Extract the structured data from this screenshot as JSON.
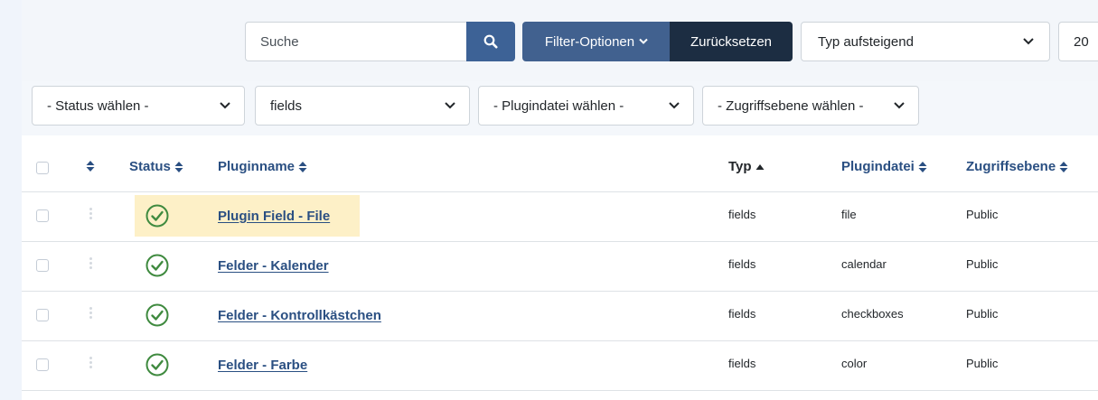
{
  "toolbar": {
    "search_placeholder": "Suche",
    "filter_label": "Filter-Optionen",
    "reset_label": "Zurücksetzen",
    "sort_value": "Typ aufsteigend",
    "limit_value": "20"
  },
  "filters": {
    "status": "- Status wählen -",
    "folder": "fields",
    "element": "- Plugindatei wählen -",
    "access": "- Zugriffsebene wählen -"
  },
  "table": {
    "columns": {
      "status": "Status",
      "name": "Pluginname",
      "type": "Typ",
      "element": "Plugindatei",
      "access": "Zugriffsebene"
    },
    "rows": [
      {
        "name": "Plugin Field - File",
        "type": "fields",
        "element": "file",
        "access": "Public"
      },
      {
        "name": "Felder - Kalender",
        "type": "fields",
        "element": "calendar",
        "access": "Public"
      },
      {
        "name": "Felder - Kontrollkästchen",
        "type": "fields",
        "element": "checkboxes",
        "access": "Public"
      },
      {
        "name": "Felder - Farbe",
        "type": "fields",
        "element": "color",
        "access": "Public"
      }
    ]
  },
  "colors": {
    "primary": "#41618f",
    "dark": "#1c2d42",
    "success": "#3f8a3f",
    "highlight": "#fdf0c7"
  }
}
